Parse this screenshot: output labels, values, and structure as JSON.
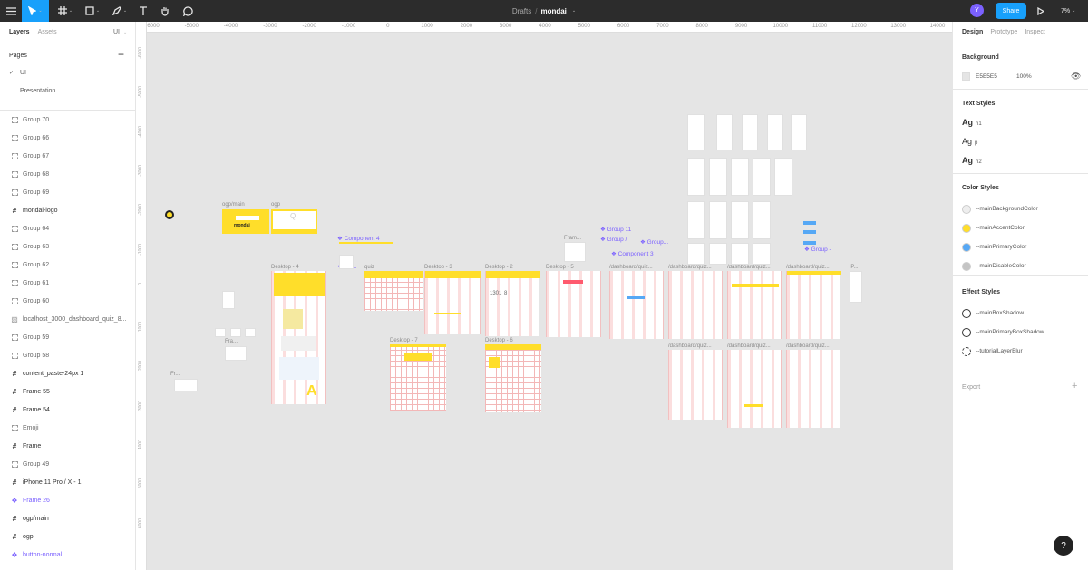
{
  "toolbar": {
    "tools": [
      "menu-icon",
      "move-tool-icon",
      "frame-tool-icon",
      "shape-tool-icon",
      "pen-tool-icon",
      "text-tool-icon",
      "hand-tool-icon",
      "comment-tool-icon"
    ],
    "breadcrumb_parent": "Drafts",
    "breadcrumb_sep": "/",
    "file_name": "mondai",
    "avatar_initial": "Y",
    "share_label": "Share",
    "zoom_label": "7%",
    "accent_color": "#18a0fb"
  },
  "left_panel": {
    "tab_layers": "Layers",
    "tab_assets": "Assets",
    "page_selector": "UI",
    "pages_header": "Pages",
    "pages": [
      {
        "label": "UI",
        "check": "✓"
      },
      {
        "label": "Presentation",
        "check": ""
      }
    ],
    "layers": [
      {
        "label": "Group 70",
        "kind": "group"
      },
      {
        "label": "Group 66",
        "kind": "group"
      },
      {
        "label": "Group 67",
        "kind": "group"
      },
      {
        "label": "Group 68",
        "kind": "group"
      },
      {
        "label": "Group 69",
        "kind": "group"
      },
      {
        "label": "mondai-logo",
        "kind": "frame"
      },
      {
        "label": "Group 64",
        "kind": "group"
      },
      {
        "label": "Group 63",
        "kind": "group"
      },
      {
        "label": "Group 62",
        "kind": "group"
      },
      {
        "label": "Group 61",
        "kind": "group"
      },
      {
        "label": "Group 60",
        "kind": "group"
      },
      {
        "label": "localhost_3000_dashboard_quiz_8...",
        "kind": "image"
      },
      {
        "label": "Group 59",
        "kind": "group"
      },
      {
        "label": "Group 58",
        "kind": "group"
      },
      {
        "label": "content_paste-24px 1",
        "kind": "frame"
      },
      {
        "label": "Frame 55",
        "kind": "frame"
      },
      {
        "label": "Frame 54",
        "kind": "frame"
      },
      {
        "label": "Emoji",
        "kind": "group"
      },
      {
        "label": "Frame",
        "kind": "frame"
      },
      {
        "label": "Group 49",
        "kind": "group"
      },
      {
        "label": "iPhone 11 Pro / X - 1",
        "kind": "frame"
      },
      {
        "label": "Frame 26",
        "kind": "component"
      },
      {
        "label": "ogp/main",
        "kind": "frame"
      },
      {
        "label": "ogp",
        "kind": "frame"
      },
      {
        "label": "button-normal",
        "kind": "component"
      }
    ]
  },
  "canvas": {
    "background": "#e5e5e5",
    "ruler_top": [
      "-6000",
      "-5000",
      "-4000",
      "-3000",
      "-2000",
      "-1000",
      "0",
      "1000",
      "2000",
      "3000",
      "4000",
      "5000",
      "6000",
      "7000",
      "8000",
      "9000",
      "10000",
      "11000",
      "12000",
      "13000",
      "14000"
    ],
    "ruler_left": [
      "-6000",
      "-5000",
      "-4000",
      "-3000",
      "-2000",
      "-1000",
      "0",
      "1000",
      "2000",
      "3000",
      "4000",
      "5000",
      "6000"
    ],
    "frame_labels": {
      "ogp_main": "ogp/main",
      "ogp": "ogp",
      "desktop4": "Desktop - 4",
      "quiz": "quiz",
      "desktop3": "Desktop - 3",
      "desktop2": "Desktop - 2",
      "desktop5": "Desktop - 5",
      "desktop7": "Desktop - 7",
      "desktop6": "Desktop - 6",
      "frame_small": "Fram...",
      "dash1": "/dashboard/quiz...",
      "dash2": "/dashboard/quiz...",
      "dash3": "/dashboard/quiz...",
      "dash4": "/dashboard/quiz...",
      "dash5": "/dashboard/quiz...",
      "dash6": "/dashboard/quiz...",
      "dash7": "/dashboard/quiz...",
      "ip": "iP...",
      "fr_small": "Fr...",
      "fra": "Fra..."
    },
    "component_labels": {
      "component4": "Component 4",
      "co": "Co...",
      "group11": "Group 11",
      "group_slash": "Group /",
      "group_dots": "Group...",
      "component3": "Component 3",
      "group_dash": "Group -"
    },
    "text_on_canvas": {
      "mondai_brand": "mondai",
      "q_glyph": "Q",
      "big_a": "A",
      "num_1301": "1301",
      "num_8": "8"
    },
    "brand_yellow": "#ffde2a",
    "primary_blue": "#56a8f5",
    "component_purple": "#7b61ff"
  },
  "right_panel": {
    "tab_design": "Design",
    "tab_prototype": "Prototype",
    "tab_inspect": "Inspect",
    "background_title": "Background",
    "background_hex": "E5E5E5",
    "background_opacity": "100%",
    "text_styles_title": "Text Styles",
    "text_styles": [
      {
        "sample": "Ag",
        "name": "h1",
        "bold": true
      },
      {
        "sample": "Ag",
        "name": "p",
        "bold": false
      },
      {
        "sample": "Ag",
        "name": "h2",
        "bold": true
      }
    ],
    "color_styles_title": "Color Styles",
    "color_styles": [
      {
        "name": "--mainBackgroundColor",
        "color": "#eeeeee"
      },
      {
        "name": "--mainAccentColor",
        "color": "#ffde2a"
      },
      {
        "name": "--mainPrimaryColor",
        "color": "#56a8f5"
      },
      {
        "name": "--mainDisableColor",
        "color": "#c4c4c4"
      }
    ],
    "effect_styles_title": "Effect Styles",
    "effect_styles": [
      {
        "name": "--mainBoxShadow"
      },
      {
        "name": "--mainPrimaryBoxShadow"
      },
      {
        "name": "--tutorialLayerBlur"
      }
    ],
    "export_title": "Export",
    "export_add": "+"
  },
  "help_label": "?"
}
